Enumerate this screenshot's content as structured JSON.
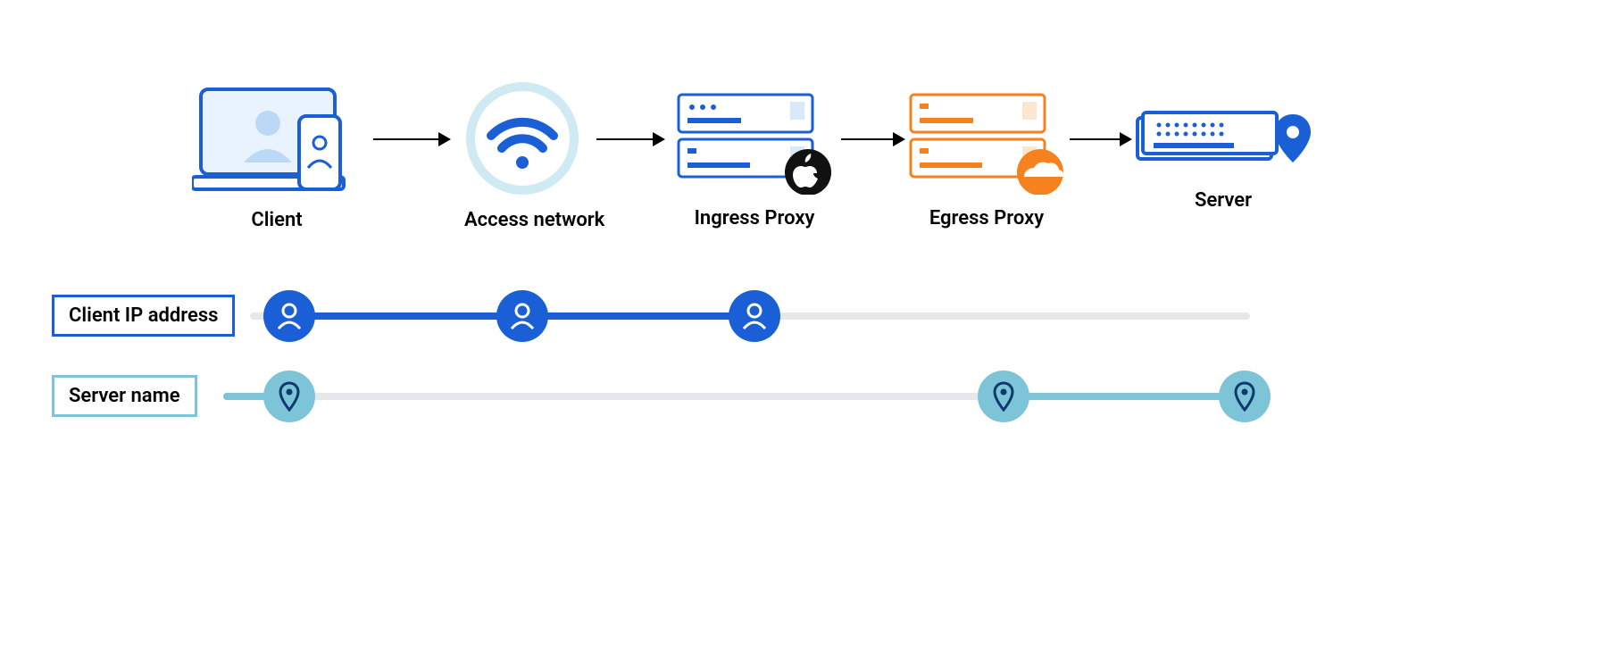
{
  "nodes": {
    "client": {
      "label": "Client"
    },
    "access": {
      "label": "Access network"
    },
    "ingress": {
      "label": "Ingress Proxy"
    },
    "egress": {
      "label": "Egress Proxy"
    },
    "server": {
      "label": "Server"
    }
  },
  "tracks": {
    "client_ip": {
      "label": "Client IP address"
    },
    "server_name": {
      "label": "Server name"
    }
  },
  "colors": {
    "primary_blue": "#1a5fd6",
    "light_teal": "#7dc4d9",
    "orange": "#f5821f",
    "pale_ring": "#cfeaf2",
    "track_bg": "#e5e7eb",
    "dark_navy": "#0b3a6b"
  }
}
